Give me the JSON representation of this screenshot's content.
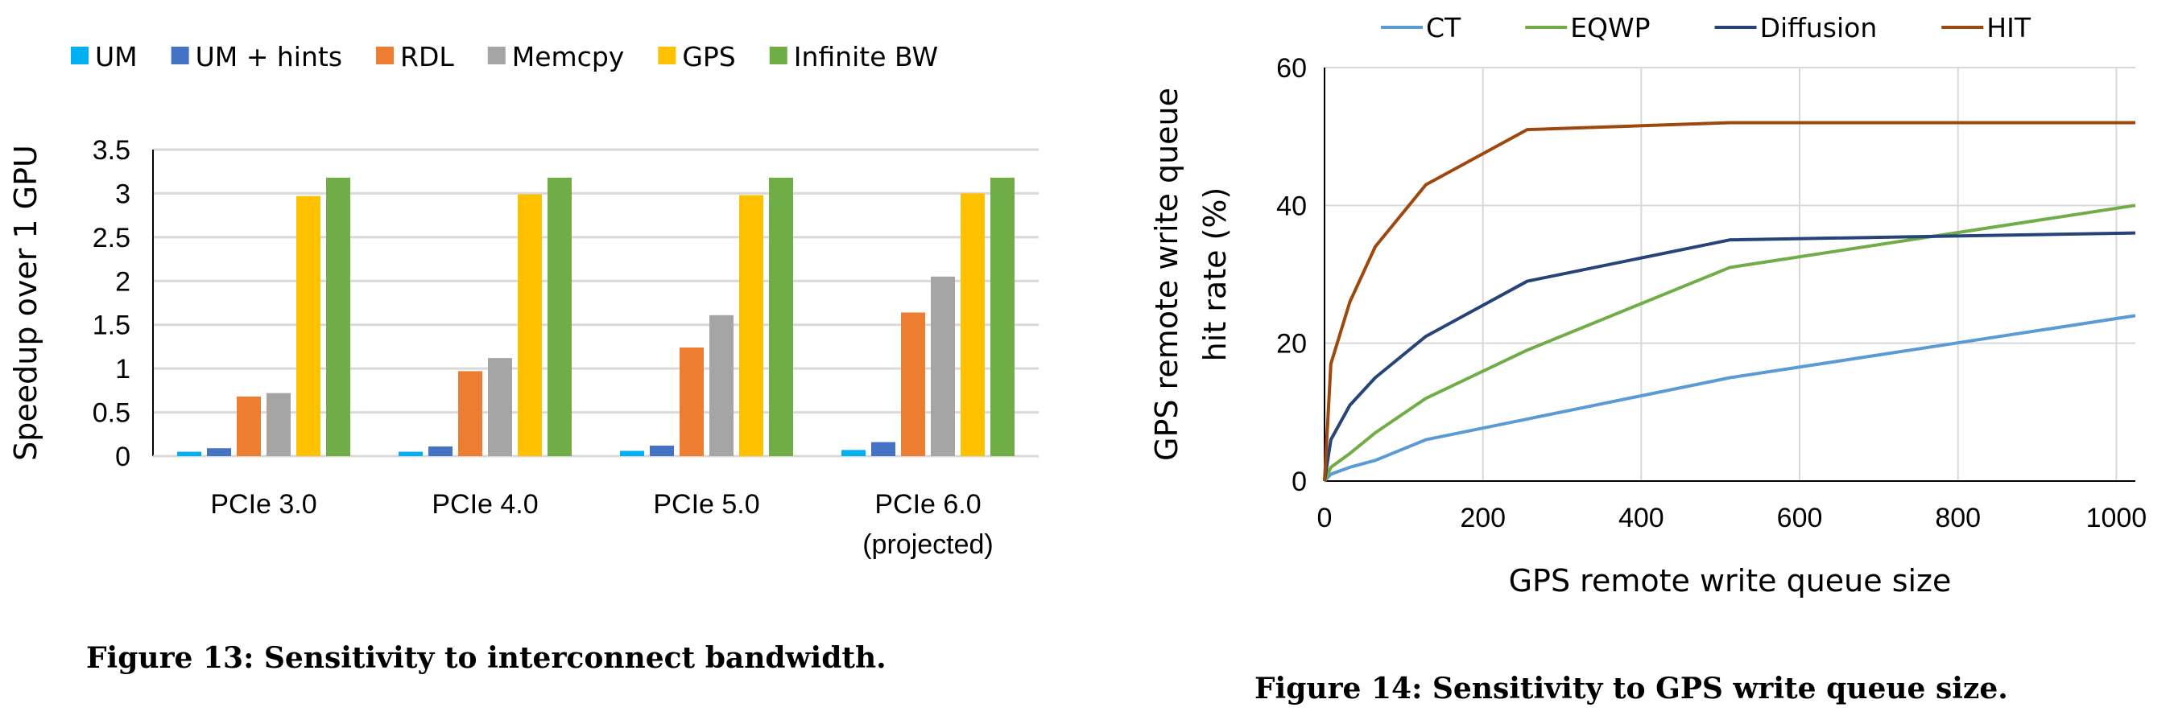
{
  "chart_data": [
    {
      "type": "bar",
      "caption": "Figure 13: Sensitivity to interconnect bandwidth.",
      "ylabel": "Speedup over 1 GPU",
      "ylim": [
        0,
        3.5
      ],
      "yticks": [
        "0",
        "0.5",
        "1",
        "1.5",
        "2",
        "2.5",
        "3",
        "3.5"
      ],
      "grid": true,
      "legend": "top",
      "categories": [
        "PCIe 3.0",
        "PCIe 4.0",
        "PCIe 5.0",
        "PCIe 6.0\n(projected)"
      ],
      "series": [
        {
          "name": "UM",
          "color": "#00b0f0",
          "values": [
            0.05,
            0.05,
            0.06,
            0.07
          ]
        },
        {
          "name": "UM + hints",
          "color": "#4472c4",
          "values": [
            0.09,
            0.11,
            0.12,
            0.16
          ]
        },
        {
          "name": "RDL",
          "color": "#ed7d31",
          "values": [
            0.68,
            0.97,
            1.24,
            1.64
          ]
        },
        {
          "name": "Memcpy",
          "color": "#a5a5a5",
          "values": [
            0.72,
            1.12,
            1.61,
            2.05
          ]
        },
        {
          "name": "GPS",
          "color": "#ffc000",
          "values": [
            2.97,
            2.99,
            2.98,
            3.0
          ]
        },
        {
          "name": "Infinite BW",
          "color": "#70ad47",
          "values": [
            3.18,
            3.18,
            3.18,
            3.18
          ]
        }
      ]
    },
    {
      "type": "line",
      "caption": "Figure 14: Sensitivity to GPS write queue size.",
      "xlabel": "GPS remote write queue size",
      "ylabel": "GPS remote write queue hit rate (%)",
      "xlim": [
        0,
        1024
      ],
      "ylim": [
        0,
        60
      ],
      "xticks": [
        "0",
        "200",
        "400",
        "600",
        "800",
        "1000"
      ],
      "yticks": [
        "0",
        "20",
        "40",
        "60"
      ],
      "grid": true,
      "legend": "top",
      "x": [
        0,
        8,
        32,
        64,
        128,
        256,
        512,
        1024
      ],
      "series": [
        {
          "name": "CT",
          "color": "#5b9bd5",
          "values": [
            0,
            1,
            2,
            3,
            6,
            9,
            15,
            24
          ]
        },
        {
          "name": "EQWP",
          "color": "#70ad47",
          "values": [
            0,
            2,
            4,
            7,
            12,
            19,
            31,
            40
          ]
        },
        {
          "name": "Diffusion",
          "color": "#264478",
          "values": [
            0,
            6,
            11,
            15,
            21,
            29,
            35,
            36
          ]
        },
        {
          "name": "HIT",
          "color": "#9e480e",
          "values": [
            0,
            17,
            26,
            34,
            43,
            51,
            52,
            52
          ]
        }
      ]
    }
  ]
}
